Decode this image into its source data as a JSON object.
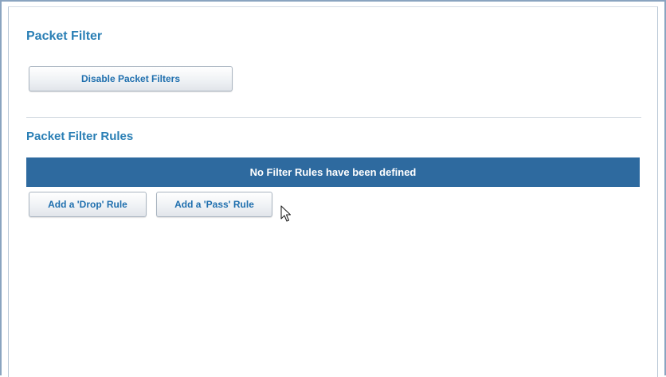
{
  "packet_filter": {
    "title": "Packet Filter",
    "disable_button_label": "Disable Packet Filters"
  },
  "rules": {
    "title": "Packet Filter Rules",
    "empty_message": "No Filter Rules have been defined",
    "add_drop_label": "Add a 'Drop' Rule",
    "add_pass_label": "Add a 'Pass' Rule"
  },
  "colors": {
    "heading": "#2a7fb5",
    "banner_bg": "#2e6a9f",
    "banner_text": "#ffffff",
    "button_text": "#1f6fae"
  },
  "icons": {
    "cursor": "mouse-pointer-icon"
  }
}
